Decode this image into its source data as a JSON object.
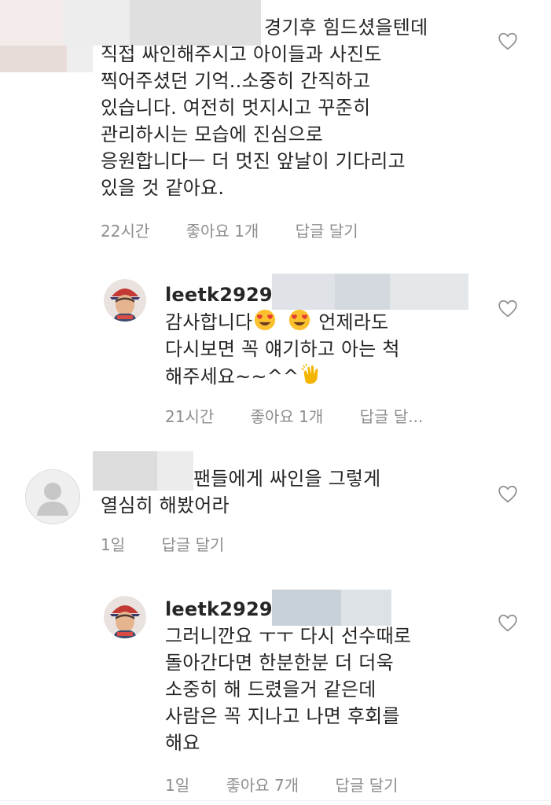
{
  "comments": [
    {
      "lines": [
        "경기후 힘드셨을텐데",
        "직접 싸인해주시고 아이들과 사진도",
        "찍어주셨던 기억..소중히 간직하고",
        "있습니다. 여전히 멋지시고 꾸준히",
        "관리하시는 모습에 진심으로",
        "응원합니다ㅡ 더 멋진 앞날이 기다리고",
        "있을 것 같아요."
      ],
      "time": "22시간",
      "likes": "좋아요 1개",
      "reply": "답글 달기"
    },
    {
      "username": "leetk2929",
      "lines": [
        "감사합니다",
        "다시보면  꼭  얘기하고 아는 척",
        "해주세요~~^^"
      ],
      "line1_suffix": " 언제라도",
      "time": "21시간",
      "likes": "좋아요 1개",
      "reply": "답글 달..."
    },
    {
      "lines": [
        "팬들에게 싸인을 그렇게",
        "열심히 해봤어라"
      ],
      "time": "1일",
      "reply": "답글 달기"
    },
    {
      "username": "leetk2929",
      "lines": [
        "그러니깐요 ㅜㅜ  다시 선수때로",
        "돌아간다면 한분한분 더 더욱",
        "소중히 해 드렸을거 같은데",
        "사람은 꼭 지나고 나면 후회를",
        "해요"
      ],
      "time": "1일",
      "likes": "좋아요 7개",
      "reply": "답글 달기"
    }
  ],
  "icons": {
    "like": "heart-outline-icon",
    "avatar_default": "default-avatar-icon",
    "emoji_heart_eyes": "heart-eyes-emoji",
    "emoji_clap": "clapping-hands-emoji"
  },
  "colors": {
    "text": "#262626",
    "meta": "#8e8e8e",
    "blur": "#d9d9d9"
  }
}
